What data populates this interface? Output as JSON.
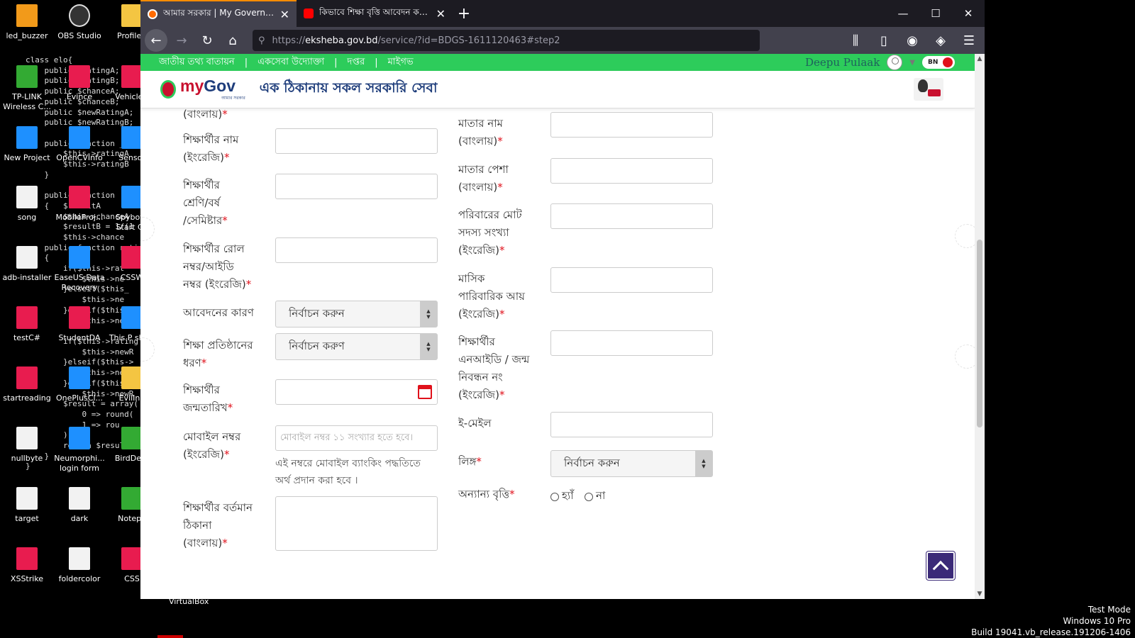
{
  "desktop": {
    "icons": [
      {
        "label": "led_buzzer",
        "kind": "g-sub"
      },
      {
        "label": "OBS Studio",
        "kind": "g-obs"
      },
      {
        "label": "ProfileC",
        "kind": "g-folder"
      },
      {
        "label": "TP-LINK Wireless C...",
        "kind": "g-wifi"
      },
      {
        "label": "Evince",
        "kind": "g-red"
      },
      {
        "label": "VehicleD",
        "kind": "g-red"
      },
      {
        "label": "New Project",
        "kind": "g-blue"
      },
      {
        "label": "OpenCVInfo",
        "kind": "g-blue"
      },
      {
        "label": "Sensor",
        "kind": "g-blue"
      },
      {
        "label": "song",
        "kind": "g-file"
      },
      {
        "label": "MobileProj...",
        "kind": "g-red"
      },
      {
        "label": "Spybot - Start Ce",
        "kind": "g-blue"
      },
      {
        "label": "adb-installer",
        "kind": "g-file"
      },
      {
        "label": "EaseUS Data Recovery",
        "kind": "g-blue"
      },
      {
        "label": "CSSW",
        "kind": "g-red"
      },
      {
        "label": "testC#",
        "kind": "g-red"
      },
      {
        "label": "StudentDA",
        "kind": "g-red"
      },
      {
        "label": "This P short",
        "kind": "g-blue"
      },
      {
        "label": "startreading",
        "kind": "g-red"
      },
      {
        "label": "OnePlusCl...",
        "kind": "g-blue"
      },
      {
        "label": "EvilInd",
        "kind": "g-folder"
      },
      {
        "label": "nullbyte",
        "kind": "g-file"
      },
      {
        "label": "Neumorphi... login form",
        "kind": "g-blue"
      },
      {
        "label": "BirdDete",
        "kind": "g-wifi"
      },
      {
        "label": "target",
        "kind": "g-file"
      },
      {
        "label": "dark",
        "kind": "g-file"
      },
      {
        "label": "Notepa",
        "kind": "g-wifi"
      },
      {
        "label": "XSStrike",
        "kind": "g-red"
      },
      {
        "label": "foldercolor",
        "kind": "g-file"
      },
      {
        "label": "CSS",
        "kind": "g-red"
      }
    ],
    "code_lines": "class elo{\n    public $ratingA;\n    public $ratingB;\n    public $chanceA;\n    public $chanceB;\n    public $newRatingA;\n    public $newRatingB;\n\n    public function __co\n        $this->ratingA\n        $this->ratingB\n    }\n\n    public function\n    {   $resultA\n        $this->chanceA\n        $resultB = 1/(1\n        $this->chance\n    public function rati\n    {\n        if($this->rat\n            $this->ne\n        }elseif($this_\n            $this->ne\n        }elseif($this->\n            $this->newR\n\n        if($this->rating\n            $this->newR\n        }elseif($this->\n            $this->newR\n        }elseif($this\n            $this->newR\n        $result = array(\n            0 => round(\n            1 => rou\n        );\n        return $result\n    }\n}",
    "watermark": [
      "Test Mode",
      "Windows 10 Pro",
      "Build 19041.vb_release.191206-1406"
    ],
    "vbox_label": "VirtualBox"
  },
  "browser": {
    "tabs": [
      {
        "title": "আমার সরকার | My Governmen",
        "active": true
      },
      {
        "title": "কিভাবে শিক্ষা বৃত্তি আবেদন করবে",
        "active": false
      }
    ],
    "new_tab": "+",
    "url_prefix": "https://",
    "url_host": "eksheba.gov.bd",
    "url_path": "/service/?id=BDGS-1611120463#step2"
  },
  "site": {
    "top_links": [
      "জাতীয় তথ্য বাতায়ন",
      "একসেবা উদ্যোক্তা",
      "দপ্তর",
      "মাইগভ"
    ],
    "separator": "|",
    "user_name": "Deepu Pulaak",
    "lang": "BN",
    "logo_my": "my",
    "logo_gov": "Gov",
    "logo_sub": "আমার সরকার",
    "tagline": "এক ঠিকানায় সকল সরকারি সেবা"
  },
  "form": {
    "left": {
      "partial_label": "(বাংলায়)",
      "student_name_en": "শিক্ষার্থীর নাম\n(ইংরেজি)",
      "class_year": "শিক্ষার্থীর\nশ্রেণি/বর্ষ\n/সেমিষ্টার",
      "roll_id": "শিক্ষার্থীর রোল\nনম্বর/আইডি\nনম্বর (ইংরেজি)",
      "reason": "আবেদনের কারণ",
      "reason_select": "নির্বাচন করুন",
      "institution_type": "শিক্ষা প্রতিষ্ঠানের\nধরণ",
      "institution_select": "নির্বাচন করুণ",
      "dob": "শিক্ষার্থীর\nজন্মতারিখ",
      "mobile": "মোবাইল নম্বর\n(ইংরেজি)",
      "mobile_placeholder": "মোবাইল নম্বর ১১ সংখ্যার হতে হবে।",
      "mobile_hint": "এই নম্বরে মোবাইল ব্যাংকিং পদ্ধতিতে\nঅর্থ প্রদান করা হবে ।",
      "address": "শিক্ষার্থীর বর্তমান\nঠিকানা\n(বাংলায়)"
    },
    "right": {
      "mother_name": "মাতার নাম\n(বাংলায়)",
      "mother_job": "মাতার পেশা\n(বাংলায়)",
      "family_size": "পরিবারের মোট\nসদস্য সংখ্যা\n(ইংরেজি)",
      "monthly_income": "মাসিক\nপারিবারিক আয়\n(ইংরেজি)",
      "nid": "শিক্ষার্থীর\nএনআইডি / জন্ম\nনিবন্ধন নং\n(ইংরেজি)",
      "email": "ই-মেইল",
      "gender": "লিঙ্গ",
      "gender_select": "নির্বাচন করুন",
      "other_scholarship": "অন্যান্য বৃত্তি",
      "yes": "হ্যাঁ",
      "no": "না"
    },
    "required_mark": "*"
  },
  "colors": {
    "green_bar": "#2dcc5b",
    "brand_blue": "#1e3d7b",
    "required_red": "#e0111b",
    "backtop": "#3b2a78"
  }
}
